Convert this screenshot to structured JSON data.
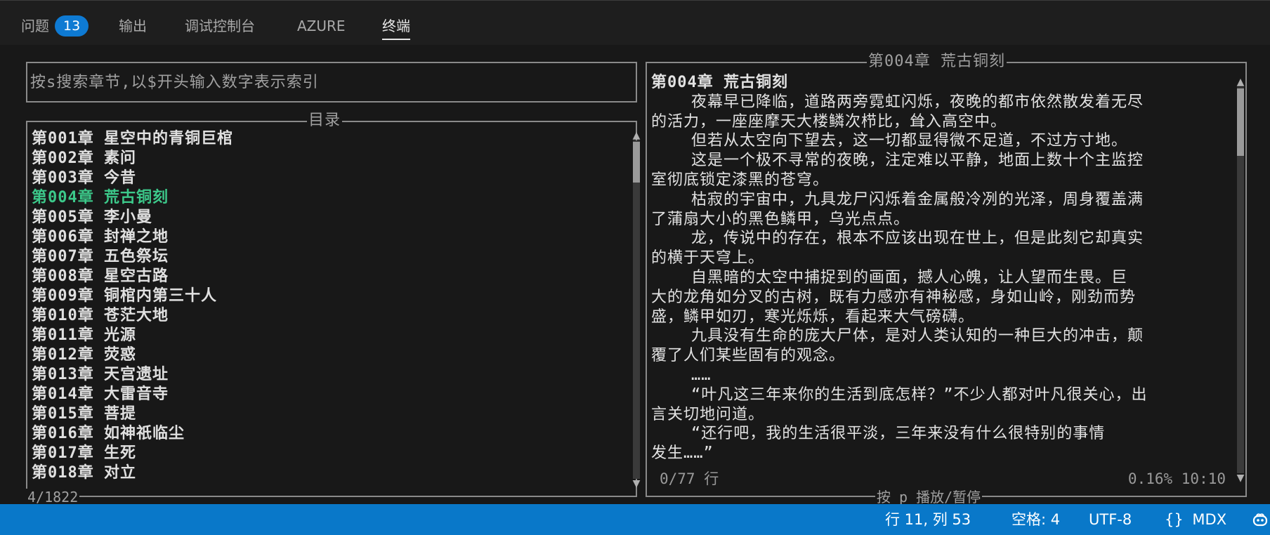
{
  "tabs": [
    {
      "label": "问题",
      "badge": "13"
    },
    {
      "label": "输出"
    },
    {
      "label": "调试控制台"
    },
    {
      "label": "AZURE"
    },
    {
      "label": "终端"
    }
  ],
  "search": {
    "placeholder": "按s搜索章节,以$开头输入数字表示索引"
  },
  "toc": {
    "title": "目录",
    "footer": "4/1822",
    "items": [
      "第001章 星空中的青铜巨棺",
      "第002章 素问",
      "第003章 今昔",
      "第004章 荒古铜刻",
      "第005章 李小曼",
      "第006章 封禅之地",
      "第007章 五色祭坛",
      "第008章 星空古路",
      "第009章 铜棺内第三十人",
      "第010章 苍茫大地",
      "第011章 光源",
      "第012章 荧惑",
      "第013章 天宫遗址",
      "第014章 大雷音寺",
      "第015章 菩提",
      "第016章 如神祇临尘",
      "第017章 生死",
      "第018章 对立"
    ]
  },
  "reader": {
    "title": "第004章 荒古铜刻",
    "footer": "按 p 播放/暂停",
    "lines": [
      "第004章 荒古铜刻",
      "    夜幕早已降临，道路两旁霓虹闪烁，夜晚的都市依然散发着无尽",
      "的活力，一座座摩天大楼鳞次栉比，耸入高空中。",
      "    但若从太空向下望去，这一切都显得微不足道，不过方寸地。",
      "    这是一个极不寻常的夜晚，注定难以平静，地面上数十个主监控",
      "室彻底锁定漆黑的苍穹。",
      "    枯寂的宇宙中，九具龙尸闪烁着金属般冷冽的光泽，周身覆盖满",
      "了蒲扇大小的黑色鳞甲，乌光点点。",
      "    龙，传说中的存在，根本不应该出现在世上，但是此刻它却真实",
      "的横于天穹上。",
      "    自黑暗的太空中捕捉到的画面，撼人心魄，让人望而生畏。巨",
      "大的龙角如分叉的古树，既有力感亦有神秘感，身如山岭，刚劲而势",
      "盛，鳞甲如刃，寒光烁烁，看起来大气磅礴。",
      "    九具没有生命的庞大尸体，是对人类认知的一种巨大的冲击，颠",
      "覆了人们某些固有的观念。",
      "    ……",
      "    “叶凡这三年来你的生活到底怎样？”不少人都对叶凡很关心，出",
      "言关切地问道。",
      "    “还行吧，我的生活很平淡，三年来没有什么很特别的事情",
      "发生……”"
    ],
    "status_left": "0/77 行",
    "status_right": "0.16% 10:10"
  },
  "statusbar": {
    "position": "行 11, 列 53",
    "spaces": "空格: 4",
    "encoding": "UTF-8",
    "language_icon": "{}",
    "language": "MDX"
  },
  "colors": {
    "accent": "#0978c9",
    "badge": "#0e7ad3",
    "current_chapter": "#3cc98a"
  }
}
